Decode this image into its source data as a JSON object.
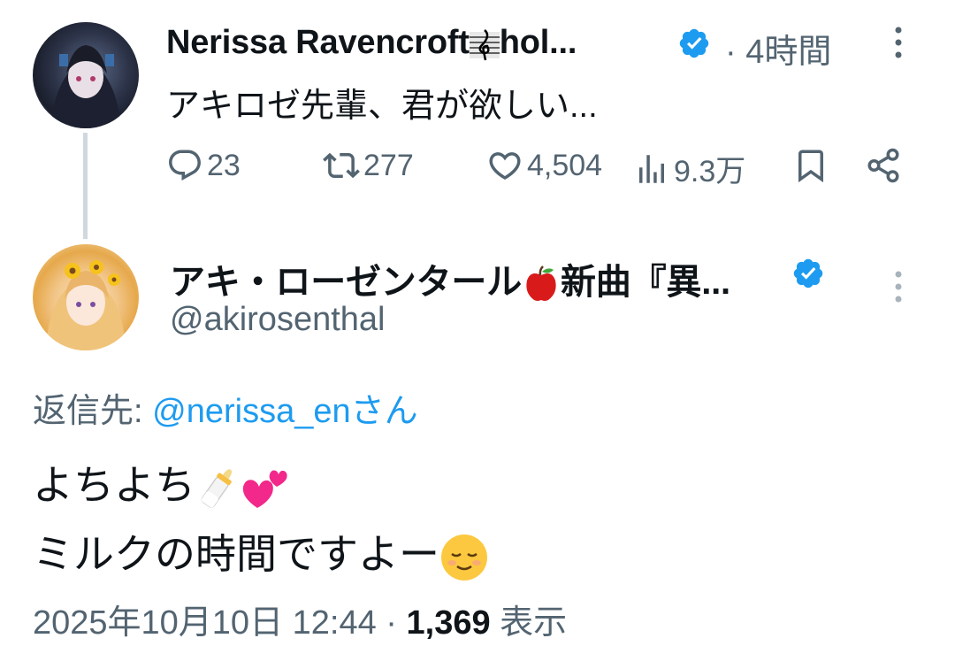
{
  "tweet1": {
    "display_name": "Nerissa Ravencroft",
    "name_suffix": "hol...",
    "separator": "·",
    "time": "4時間",
    "text": "アキロゼ先輩、君が欲しい...",
    "replies": "23",
    "retweets": "277",
    "likes": "4,504",
    "views": "9.3万"
  },
  "tweet2": {
    "display_name": "アキ・ローゼンタール",
    "name_suffix": "新曲『異...",
    "handle": "@akirosenthal",
    "reply_prefix": "返信先: ",
    "reply_mention": "@nerissa_en",
    "reply_suffix": "さん",
    "line1": "よちよち",
    "line2": "ミルクの時間ですよー",
    "timestamp": "2025年10月10日 12:44",
    "separator": "·",
    "view_count": "1,369",
    "view_label": "表示"
  },
  "colors": {
    "verified": "#1d9bf0",
    "secondary_text": "#536471",
    "link": "#1d9bf0"
  },
  "icons": [
    "reply-icon",
    "retweet-icon",
    "like-icon",
    "views-icon",
    "bookmark-icon",
    "share-icon",
    "verified-icon",
    "more-icon",
    "treble-clef-icon",
    "apple-icon",
    "baby-bottle-icon",
    "two-hearts-icon",
    "relieved-face-icon"
  ]
}
